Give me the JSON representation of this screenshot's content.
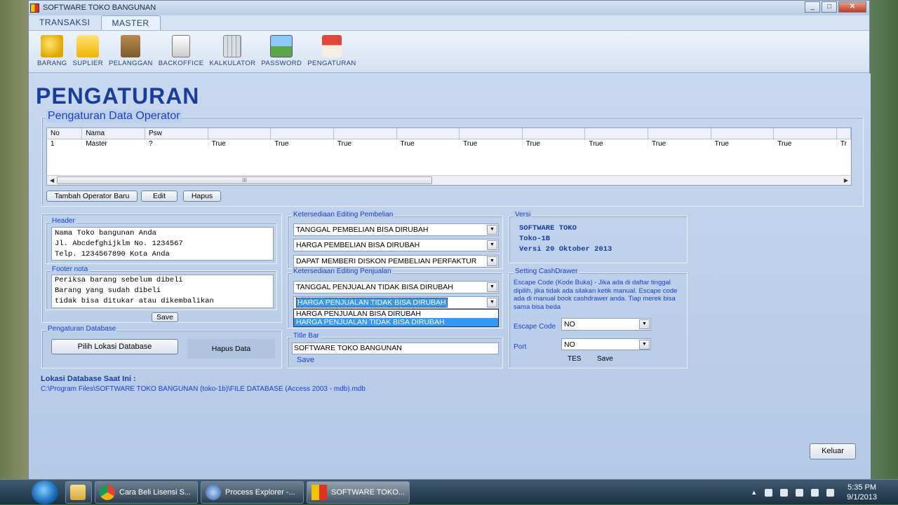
{
  "window": {
    "title": "SOFTWARE TOKO BANGUNAN"
  },
  "ribbon": {
    "tabs": [
      {
        "label": "TRANSAKSI"
      },
      {
        "label": "MASTER"
      }
    ],
    "buttons": [
      {
        "label": "BARANG",
        "icon": "coins-icon"
      },
      {
        "label": "SUPLIER",
        "icon": "folder-icon"
      },
      {
        "label": "PELANGGAN",
        "icon": "box-icon"
      },
      {
        "label": "BACKOFFICE",
        "icon": "document-lock-icon"
      },
      {
        "label": "KALKULATOR",
        "icon": "calculator-icon"
      },
      {
        "label": "PASSWORD",
        "icon": "landscape-lock-icon"
      },
      {
        "label": "PENGATURAN",
        "icon": "house-icon"
      }
    ]
  },
  "page": {
    "title": "PENGATURAN"
  },
  "operator": {
    "group_title": "Pengaturan Data Operator",
    "columns": [
      "No",
      "Nama",
      "Psw",
      "",
      "",
      "",
      "",
      "",
      "",
      "",
      "",
      "",
      "",
      ""
    ],
    "row": [
      "1",
      "Master",
      "?",
      "True",
      "True",
      "True",
      "True",
      "True",
      "True",
      "True",
      "True",
      "True",
      "True",
      "Tr"
    ],
    "buttons": {
      "add": "Tambah Operator Baru",
      "edit": "Edit",
      "delete": "Hapus"
    }
  },
  "header": {
    "title": "Header",
    "lines": [
      "Nama Toko bangunan Anda",
      "Jl. Abcdefghijklm No. 1234567",
      "Telp. 1234567890 Kota Anda"
    ]
  },
  "footer": {
    "title": "Footer nota",
    "lines": [
      "Periksa barang sebelum dibeli",
      "Barang yang sudah dibeli",
      "tidak bisa ditukar atau dikembalikan"
    ],
    "save": "Save"
  },
  "database": {
    "title": "Pengaturan Database",
    "choose": "Pilih Lokasi Database",
    "delete": "Hapus Data"
  },
  "purchase": {
    "title": "Ketersediaan Editing Pembelian",
    "options": [
      "TANGGAL PEMBELIAN BISA DIRUBAH",
      "HARGA PEMBELIAN BISA DIRUBAH",
      "DAPAT MEMBERI DISKON PEMBELIAN PERFAKTUR"
    ]
  },
  "sales": {
    "title": "Ketersediaan Editing Penjualan",
    "date_option": "TANGGAL PENJUALAN TIDAK BISA DIRUBAH",
    "price_option": "HARGA PENJUALAN TIDAK BISA DIRUBAH",
    "dropdown": [
      "HARGA PENJUALAN BISA DIRUBAH",
      "HARGA PENJUALAN TIDAK BISA DIRUBAH"
    ]
  },
  "titlebar_setting": {
    "title": "Title Bar",
    "value": "SOFTWARE TOKO BANGUNAN",
    "save": "Save"
  },
  "version": {
    "title": "Versi",
    "lines": [
      "SOFTWARE TOKO",
      "Toko-1B",
      "Versi 20 Oktober 2013"
    ]
  },
  "cashdrawer": {
    "title": "Setting CashDrawer",
    "note": "Escape Code (Kode Buka) - Jika ada di daftar tinggal dipilih, jika tidak ada silakan ketik manual. Escape code ada di manual book cashdrawer anda. Tiap merek bisa sama bisa beda",
    "escape_label": "Escape Code",
    "escape_value": "NO",
    "port_label": "Port",
    "port_value": "NO",
    "test": "TES",
    "save": "Save"
  },
  "location": {
    "label": "Lokasi Database Saat Ini :",
    "path": "C:\\Program Files\\SOFTWARE TOKO BANGUNAN (toko-1b)\\FILE DATABASE (Access 2003 - mdb).mdb"
  },
  "exit": {
    "label": "Keluar"
  },
  "taskbar": {
    "items": [
      {
        "label": "Cara Beli Lisensi S..."
      },
      {
        "label": "Process Explorer -..."
      },
      {
        "label": "SOFTWARE TOKO..."
      }
    ],
    "time": "5:35 PM",
    "date": "9/1/2013"
  },
  "colors": {
    "accent": "#1a3d9c",
    "link_blue": "#1a3dd6",
    "selection": "#3399ff"
  }
}
